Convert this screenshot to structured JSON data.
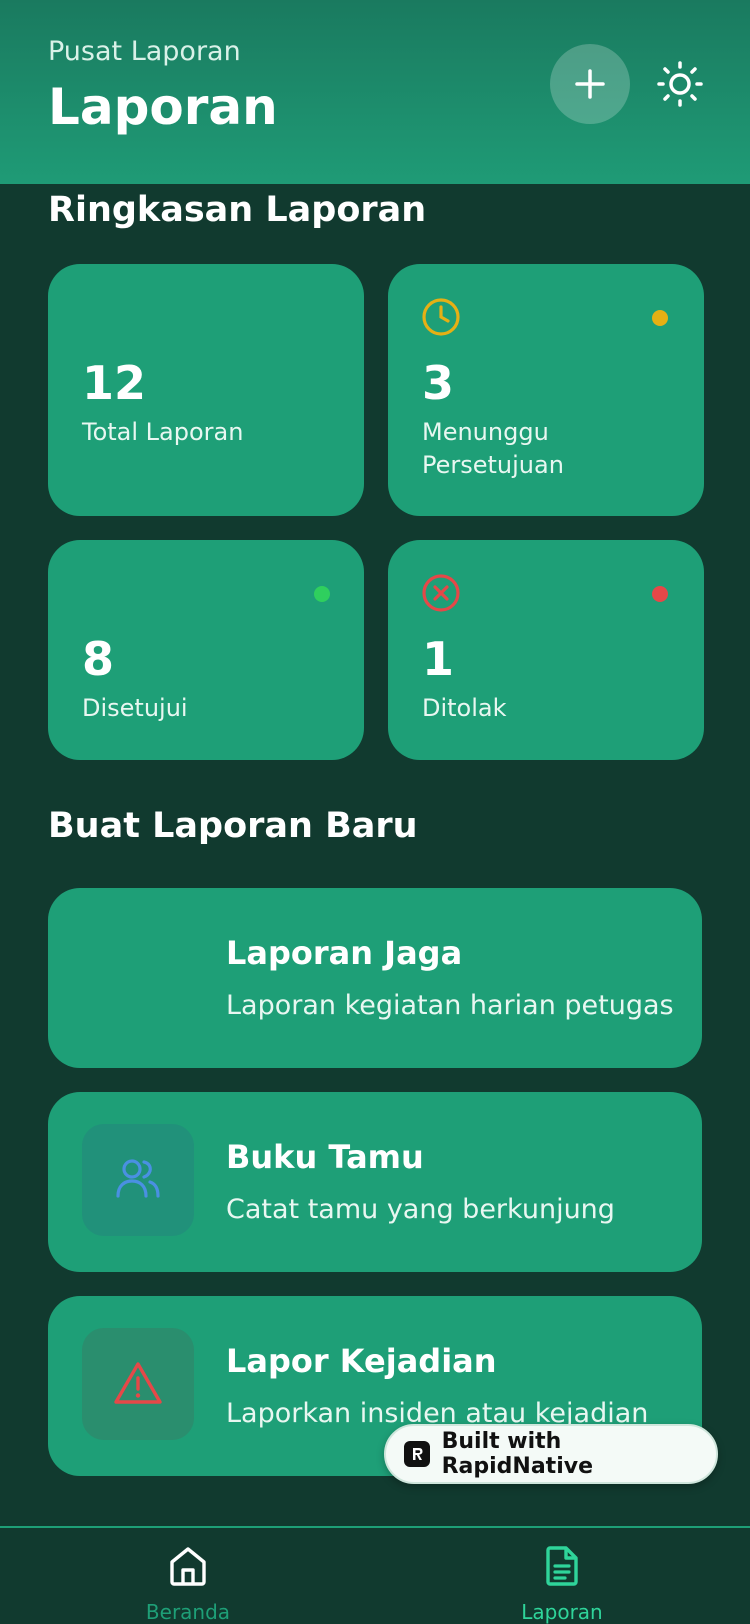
{
  "header": {
    "subtitle": "Pusat Laporan",
    "title": "Laporan",
    "add_icon": "plus-icon",
    "theme_icon": "sun-icon"
  },
  "summary": {
    "title": "Ringkasan Laporan",
    "cards": [
      {
        "value": "12",
        "label": "Total Laporan"
      },
      {
        "value": "3",
        "label": "Menunggu Persetujuan",
        "icon": "clock-icon",
        "dot_color": "#e6b014"
      },
      {
        "value": "8",
        "label": "Disetujui",
        "dot_color": "#2fcf5e"
      },
      {
        "value": "1",
        "label": "Ditolak",
        "icon": "x-circle-icon",
        "dot_color": "#e54848"
      }
    ]
  },
  "create": {
    "title": "Buat Laporan Baru",
    "items": [
      {
        "title": "Laporan Jaga",
        "desc": "Laporan kegiatan harian petugas"
      },
      {
        "title": "Buku Tamu",
        "desc": "Catat tamu yang berkunjung",
        "icon": "users-icon"
      },
      {
        "title": "Lapor Kejadian",
        "desc": "Laporkan insiden atau kejadian",
        "icon": "warning-icon"
      }
    ]
  },
  "badge": {
    "text": "Built with RapidNative"
  },
  "tabs": [
    {
      "label": "Beranda",
      "icon": "home-icon"
    },
    {
      "label": "Laporan",
      "icon": "document-icon"
    }
  ],
  "colors": {
    "background": "#113a2f",
    "card": "#1e9f77",
    "tab_active": "#2fd49a"
  }
}
